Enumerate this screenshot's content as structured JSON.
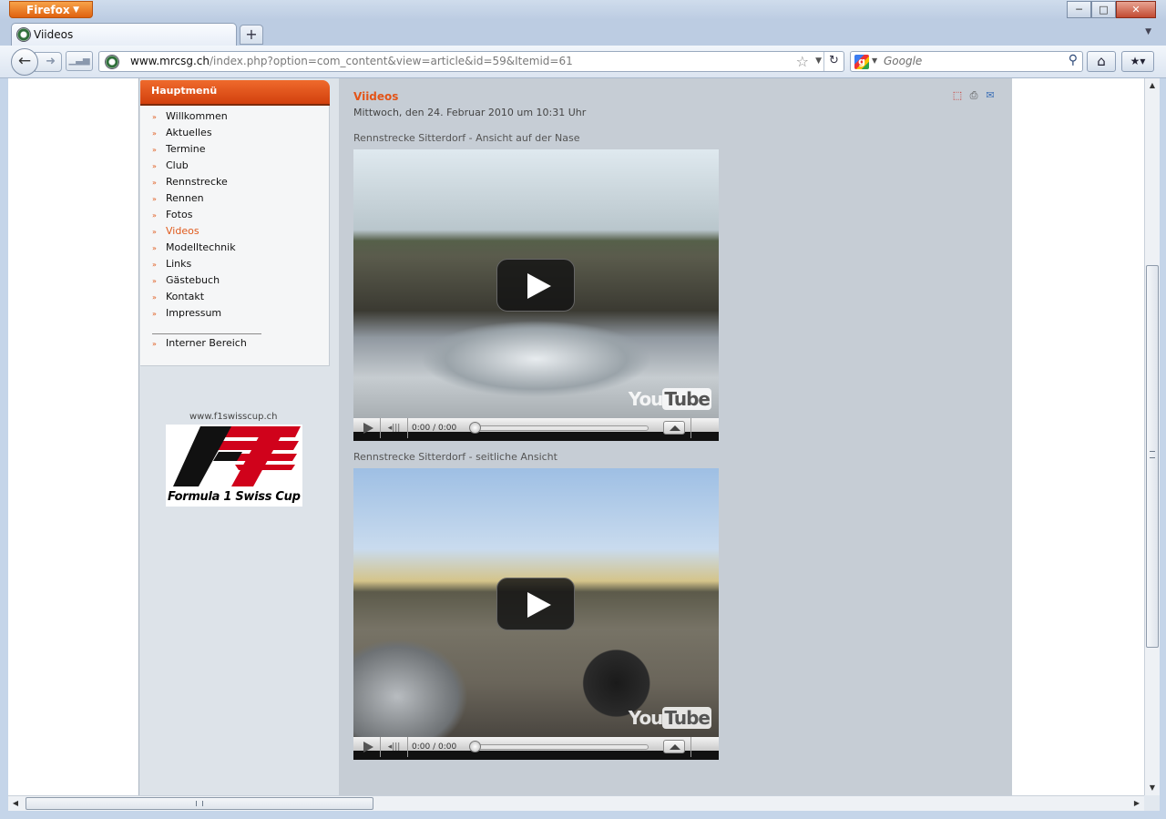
{
  "browser": {
    "app_button": "Firefox",
    "tab_title": "Viideos",
    "url_domain": "www.mrcsg.ch",
    "url_path": "/index.php?option=com_content&view=article&id=59&Itemid=61",
    "search_engine_placeholder": "Google",
    "window_controls": {
      "minimize": "─",
      "maximize": "□",
      "close": "✕"
    }
  },
  "sidebar": {
    "header": "Hauptmenü",
    "items": [
      {
        "label": "Willkommen",
        "active": false
      },
      {
        "label": "Aktuelles",
        "active": false
      },
      {
        "label": "Termine",
        "active": false
      },
      {
        "label": "Club",
        "active": false
      },
      {
        "label": "Rennstrecke",
        "active": false
      },
      {
        "label": "Rennen",
        "active": false
      },
      {
        "label": "Fotos",
        "active": false
      },
      {
        "label": "Videos",
        "active": true
      },
      {
        "label": "Modelltechnik",
        "active": false
      },
      {
        "label": "Links",
        "active": false
      },
      {
        "label": "Gästebuch",
        "active": false
      },
      {
        "label": "Kontakt",
        "active": false
      },
      {
        "label": "Impressum",
        "active": false
      }
    ],
    "internal": "Interner Bereich",
    "bullet": "»",
    "sponsor_url": "www.f1swisscup.ch",
    "sponsor_name": "Formula 1 Swiss Cup"
  },
  "article": {
    "title": "Viideos",
    "date": "Mittwoch, den 24. Februar 2010 um 10:31 Uhr",
    "videos": [
      {
        "caption": "Rennstrecke Sitterdorf - Ansicht auf der Nase",
        "time": "0:00 / 0:00",
        "brand_you": "You",
        "brand_tube": "Tube"
      },
      {
        "caption": "Rennstrecke Sitterdorf - seitliche Ansicht",
        "time": "0:00 / 0:00",
        "brand_you": "You",
        "brand_tube": "Tube"
      }
    ]
  },
  "colors": {
    "accent": "#e35418",
    "menu_header": "#d94a12",
    "page_bg": "#dde3e9",
    "main_bg": "#c6cdd5"
  }
}
